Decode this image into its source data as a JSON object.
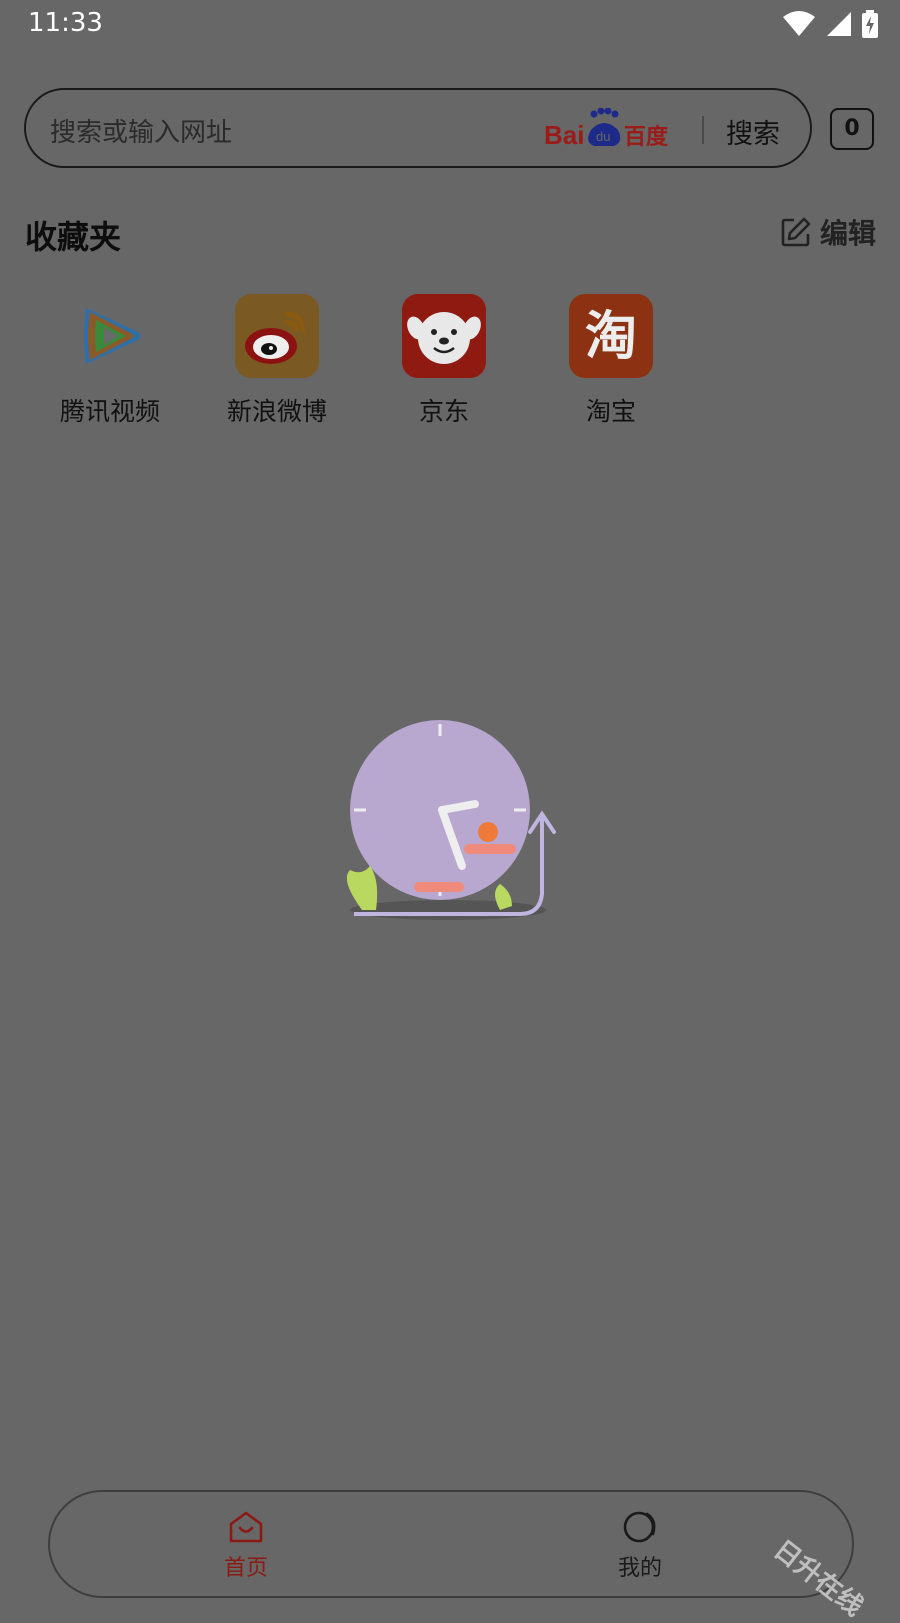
{
  "status_bar": {
    "time": "11:33",
    "icons": [
      "wifi-icon",
      "signal-icon",
      "battery-icon"
    ]
  },
  "search": {
    "placeholder": "搜索或输入网址",
    "engine_logo": "Bai du 百度",
    "button_label": "搜索"
  },
  "tab_count": "0",
  "favorites": {
    "title": "收藏夹",
    "edit_label": "编辑",
    "items": [
      {
        "label": "腾讯视频",
        "icon": "tencent-video-icon"
      },
      {
        "label": "新浪微博",
        "icon": "weibo-icon"
      },
      {
        "label": "京东",
        "icon": "jd-icon"
      },
      {
        "label": "淘宝",
        "icon": "taobao-icon",
        "glyph": "淘"
      }
    ]
  },
  "empty_state": {
    "illustration": "clock-illustration"
  },
  "bottom_nav": {
    "items": [
      {
        "label": "首页",
        "icon": "home-icon",
        "active": true
      },
      {
        "label": "我的",
        "icon": "profile-icon",
        "active": false
      }
    ]
  },
  "watermark": "日升在线",
  "colors": {
    "background": "#676767",
    "accent": "#8b1a14",
    "search_border": "#1a1a1a"
  }
}
